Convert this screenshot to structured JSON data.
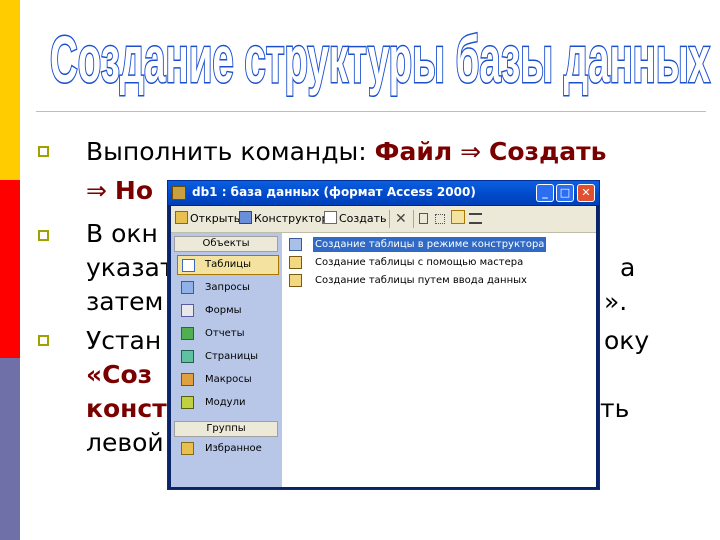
{
  "slide": {
    "title": "Создание структуры базы данных",
    "colors": {
      "title_fill": "#ffffff",
      "title_stroke": "#1a4fd0",
      "accent_red": "#7a0000",
      "bar_yellow": "#ffcc00",
      "bar_red": "#ff0000",
      "bar_purple": "#7070a8"
    },
    "line1": {
      "text": "Выполнить команды: ",
      "cmd1": "Файл",
      "arrow": "⇒",
      "cmd2": "Создать"
    },
    "line2": {
      "arrow": "⇒",
      "cmd": "Но"
    },
    "line3": "В окн",
    "line4_left": "указат",
    "line4_right": "а",
    "line5_left": "затем",
    "line5_right": "».",
    "line6_left": "Устан",
    "line6_right": "оку",
    "line7": "«Соз",
    "line8_left": "конст",
    "line8_right": "ть",
    "line9": "левой"
  },
  "window": {
    "title": "db1 : база данных (формат Access 2000)",
    "buttons": {
      "minimize": "_",
      "maximize": "□",
      "close": "✕"
    },
    "toolbar": {
      "open": "Открыть",
      "constructor": "Конструктор",
      "create": "Создать",
      "delete": "✕"
    },
    "nav": {
      "header": "Объекты",
      "items": [
        "Таблицы",
        "Запросы",
        "Формы",
        "Отчеты",
        "Страницы",
        "Макросы",
        "Модули"
      ],
      "selected": "Таблицы",
      "groups_header": "Группы",
      "favorites": "Избранное"
    },
    "list": {
      "items": [
        "Создание таблицы в режиме конструктора",
        "Создание таблицы с помощью мастера",
        "Создание таблицы путем ввода данных"
      ],
      "selected_index": 0
    }
  }
}
